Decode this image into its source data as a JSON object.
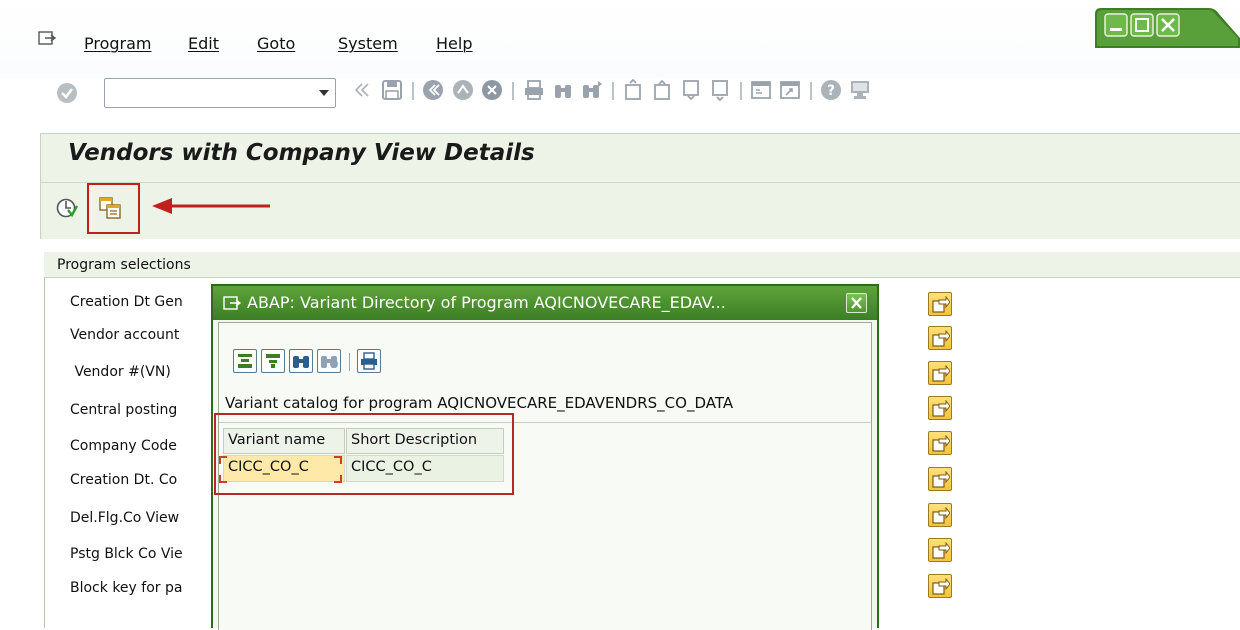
{
  "menu": {
    "items": [
      {
        "label": "Program"
      },
      {
        "label": "Edit"
      },
      {
        "label": "Goto"
      },
      {
        "label": "System"
      },
      {
        "label": "Help"
      }
    ]
  },
  "toolbar": {
    "command_field_value": "",
    "icons": [
      "enter-check-icon",
      "back-icon",
      "save-icon",
      "back-arrow-icon",
      "exit-icon",
      "cancel-icon",
      "print-icon",
      "find-icon",
      "find-next-icon",
      "first-page-icon",
      "prev-page-icon",
      "next-page-icon",
      "last-page-icon",
      "new-session-icon",
      "shortcut-icon",
      "help-icon",
      "layout-icon"
    ]
  },
  "screen": {
    "title": "Vendors with Company View Details"
  },
  "selections": {
    "title": "Program selections",
    "fields": [
      {
        "label": "Creation Dt Gen"
      },
      {
        "label": "Vendor account"
      },
      {
        "label": " Vendor #(VN)"
      },
      {
        "label": "Central posting"
      },
      {
        "label": "Company Code"
      },
      {
        "label": "Creation Dt. Co"
      },
      {
        "label": "Del.Flg.Co View"
      },
      {
        "label": "Pstg Blck Co Vie"
      },
      {
        "label": "Block key for pa"
      }
    ]
  },
  "popup": {
    "title": "ABAP: Variant Directory of Program AQICNOVECARE_EDAV...",
    "catalog_text": "Variant catalog for program AQICNOVECARE_EDAVENDRS_CO_DATA",
    "columns": [
      "Variant name",
      "Short Description"
    ],
    "rows": [
      {
        "variant": "CICC_CO_C",
        "description": "CICC_CO_C"
      }
    ]
  },
  "colors": {
    "popup_titlebar": "#4b8f2f",
    "screen_panel": "#edf3e6",
    "highlight_red": "#c0201e",
    "selected_cell": "#ffe9a8"
  }
}
